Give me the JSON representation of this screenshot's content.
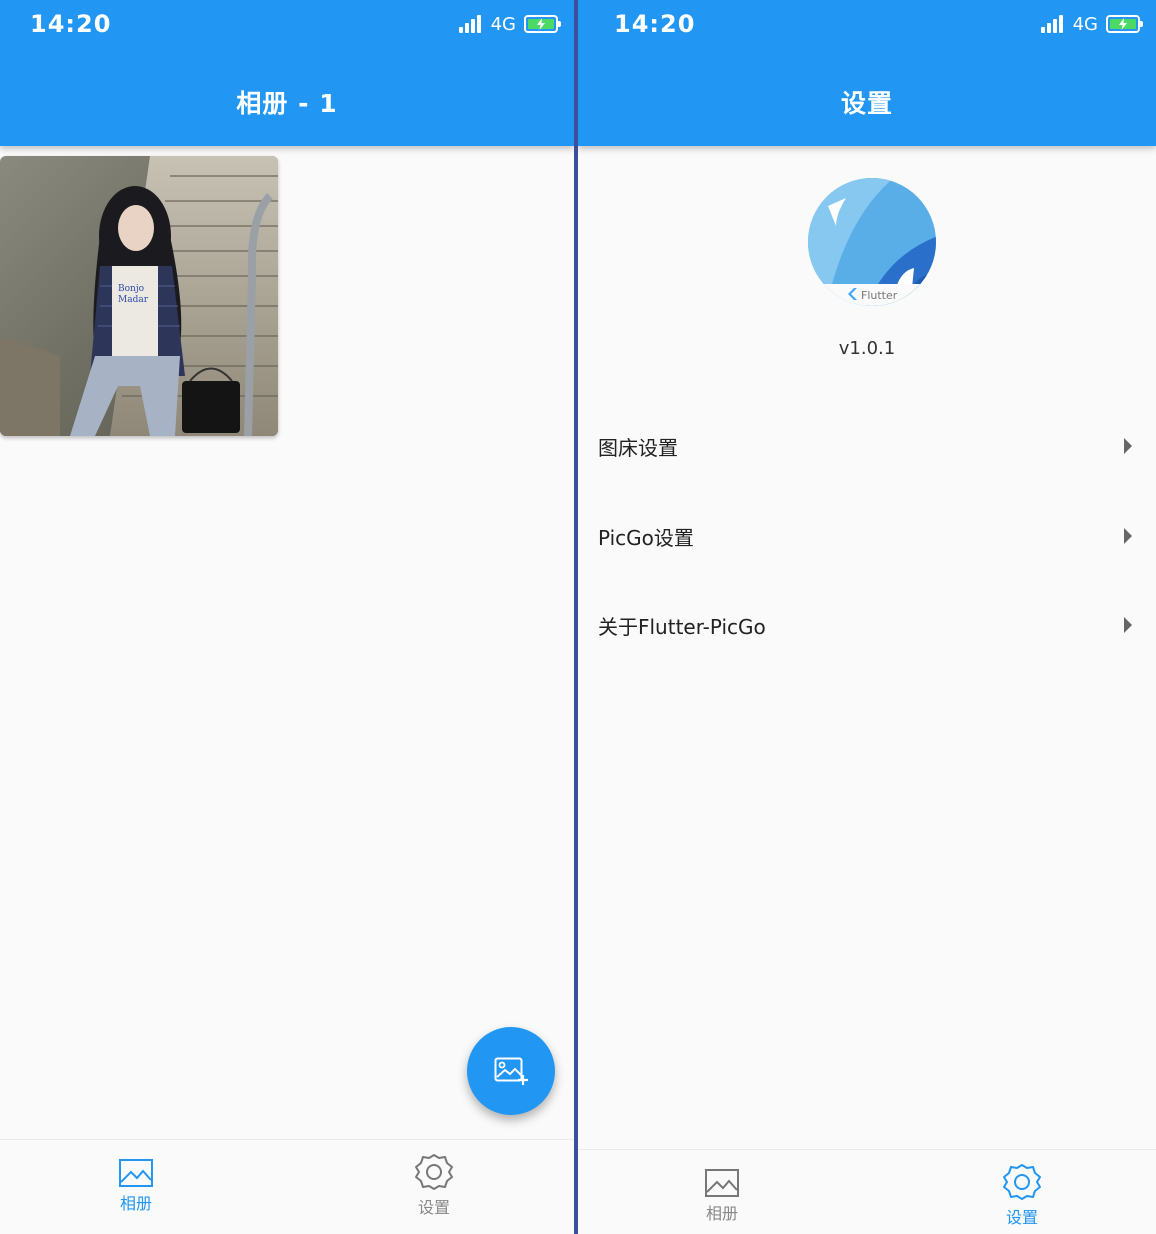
{
  "left": {
    "status": {
      "time": "14:20",
      "network": "4G"
    },
    "appbar": {
      "title": "相册 - 1"
    },
    "bottom_nav": [
      {
        "label": "相册",
        "active": true
      },
      {
        "label": "设置",
        "active": false
      }
    ]
  },
  "right": {
    "status": {
      "time": "14:20",
      "network": "4G"
    },
    "appbar": {
      "title": "设置"
    },
    "logo": {
      "caption": "Flutter"
    },
    "version": "v1.0.1",
    "menu": [
      {
        "label": "图床设置"
      },
      {
        "label": "PicGo设置"
      },
      {
        "label": "关于Flutter-PicGo"
      }
    ],
    "bottom_nav": [
      {
        "label": "相册",
        "active": false
      },
      {
        "label": "设置",
        "active": true
      }
    ]
  },
  "colors": {
    "primary": "#2196f3",
    "background": "#fafafa",
    "inactive": "#888888"
  }
}
